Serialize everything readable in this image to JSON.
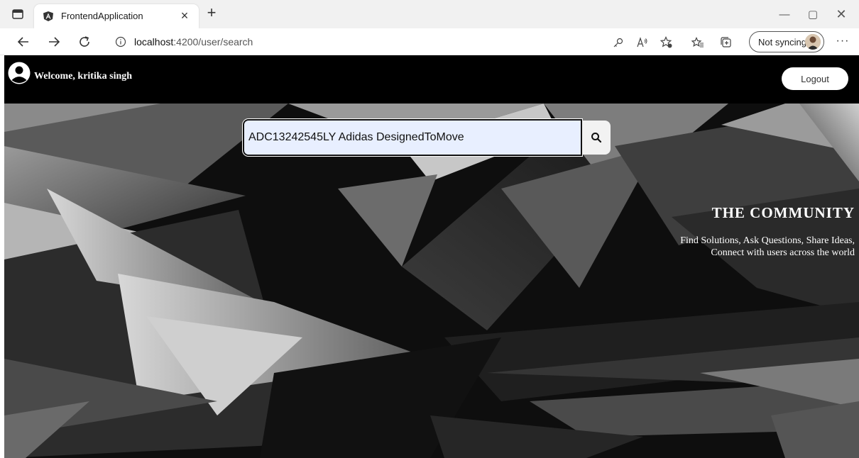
{
  "browser": {
    "tab_title": "FrontendApplication",
    "tab_close": "×",
    "new_tab": "+",
    "url_host": "localhost",
    "url_rest": ":4200/user/search",
    "sync_label": "Not syncing",
    "more": "···",
    "win_min": "—",
    "win_max": "▢",
    "win_close": "✕"
  },
  "header": {
    "welcome": "Welcome, kritika singh",
    "logout_label": "Logout"
  },
  "search": {
    "value": "ADC13242545LY Adidas DesignedToMove"
  },
  "community": {
    "title": "THE COMMUNITY",
    "line1": "Find Solutions, Ask Questions, Share Ideas,",
    "line2": "Connect with users across the world"
  },
  "colors": {
    "page_bg": "#000000",
    "search_bg": "#e8efff",
    "chrome_bg": "#f1f1f1"
  }
}
